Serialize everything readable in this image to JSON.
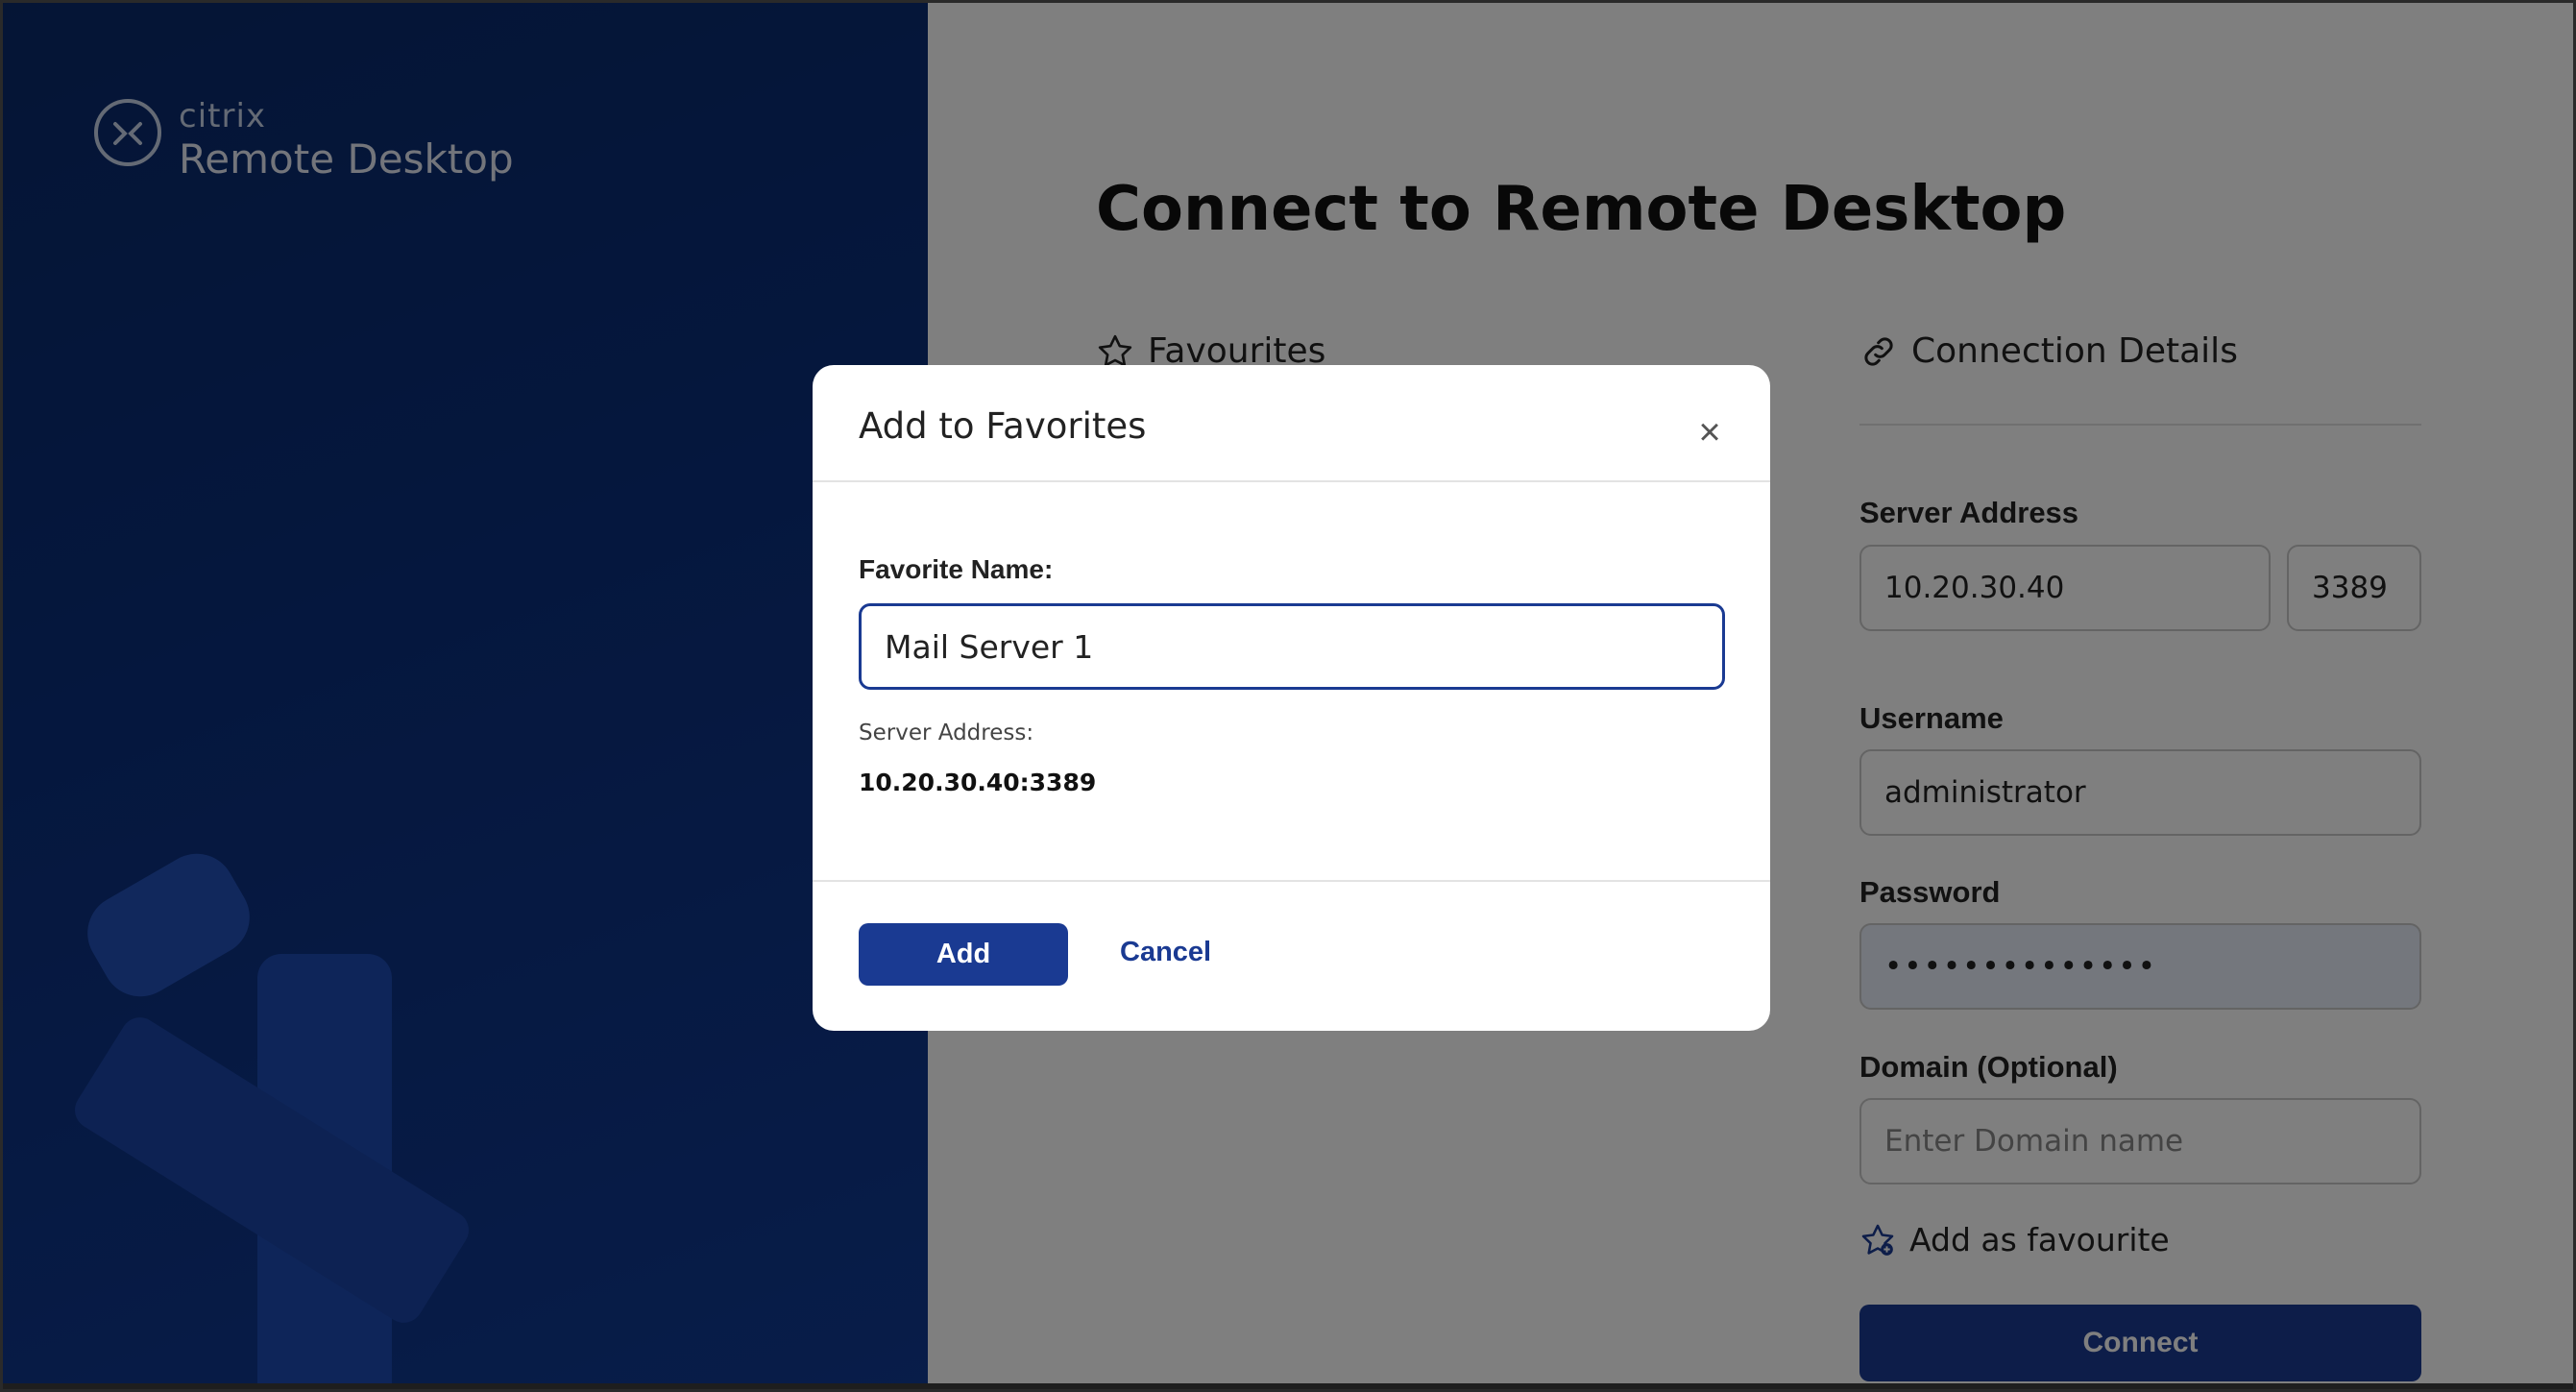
{
  "brand": {
    "company": "citrix",
    "product": "Remote Desktop"
  },
  "page": {
    "title": "Connect to Remote Desktop"
  },
  "favourites": {
    "heading": "Favourites",
    "icon": "star-outline-icon"
  },
  "connection": {
    "heading": "Connection Details",
    "icon": "link-icon",
    "server_label": "Server Address",
    "server_value": "10.20.30.40",
    "port_value": "3389",
    "username_label": "Username",
    "username_value": "administrator",
    "password_label": "Password",
    "password_value": "••••••••••••••",
    "domain_label": "Domain (Optional)",
    "domain_placeholder": "Enter Domain name",
    "add_favourite_label": "Add as favourite",
    "connect_label": "Connect"
  },
  "modal": {
    "title": "Add to Favorites",
    "close_icon": "close-icon",
    "favorite_name_label": "Favorite Name:",
    "favorite_name_value": "Mail Server 1",
    "server_address_label": "Server Address:",
    "server_address_value": "10.20.30.40:3389",
    "add_label": "Add",
    "cancel_label": "Cancel"
  },
  "colors": {
    "primary": "#1a3a92",
    "brand_panel": "#0b2f7d",
    "overlay": "rgba(0,0,0,0.5)"
  }
}
